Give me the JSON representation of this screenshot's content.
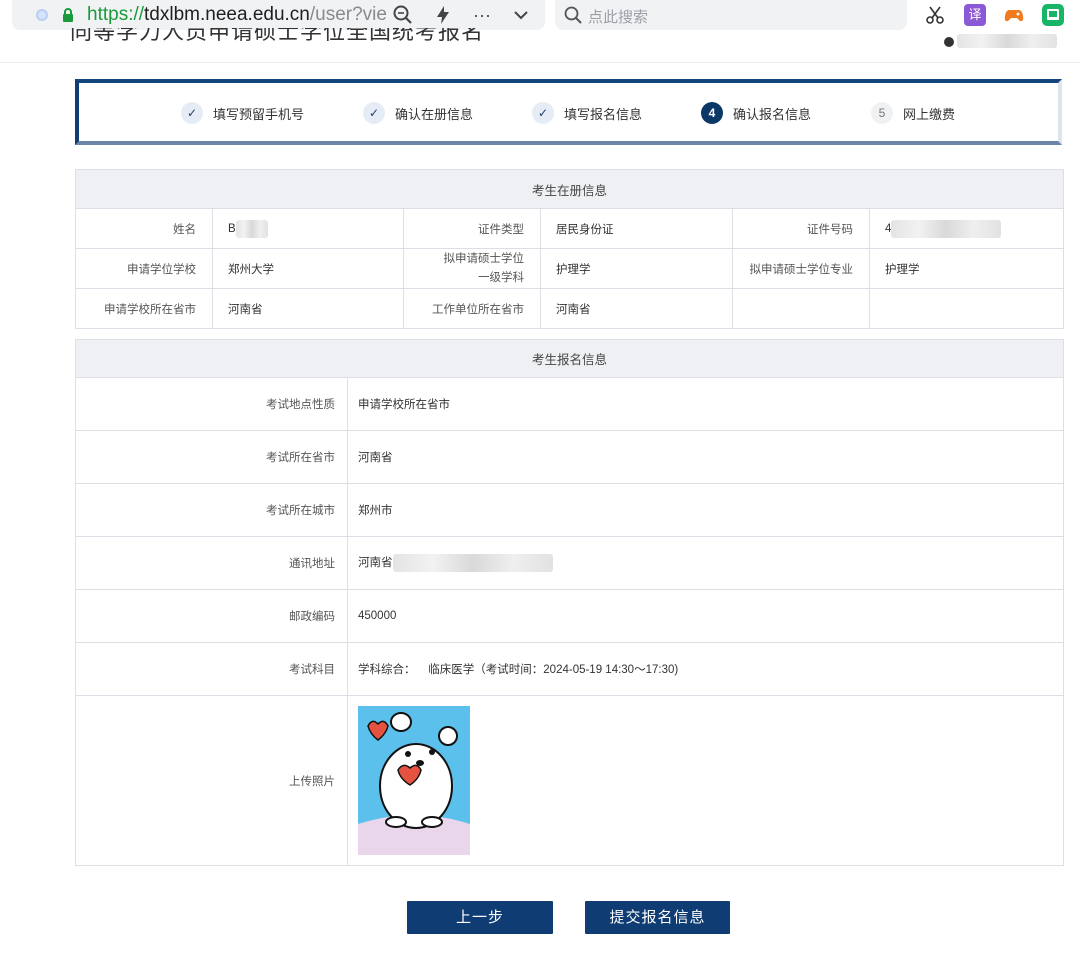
{
  "browser": {
    "url_protocol": "https://",
    "url_host": "tdxlbm.neea.edu.cn",
    "url_path": "/user?vie",
    "search_placeholder": "点此搜索",
    "ext_translate": "译"
  },
  "steps": [
    {
      "num": "",
      "label": "填写预留手机号",
      "state": "done"
    },
    {
      "num": "",
      "label": "确认在册信息",
      "state": "done"
    },
    {
      "num": "",
      "label": "填写报名信息",
      "state": "done"
    },
    {
      "num": "4",
      "label": "确认报名信息",
      "state": "current"
    },
    {
      "num": "5",
      "label": "网上缴费",
      "state": "todo"
    }
  ],
  "registry": {
    "title": "考生在册信息",
    "name_label": "姓名",
    "name_value": "B",
    "id_type_label": "证件类型",
    "id_type_value": "居民身份证",
    "id_no_label": "证件号码",
    "id_no_value": "4",
    "school_label": "申请学位学校",
    "school_value": "郑州大学",
    "discipline_label": "拟申请硕士学位一级学科",
    "discipline_value": "护理学",
    "major_label": "拟申请硕士学位专业",
    "major_value": "护理学",
    "school_province_label": "申请学校所在省市",
    "school_province_value": "河南省",
    "work_province_label": "工作单位所在省市",
    "work_province_value": "河南省"
  },
  "registration": {
    "title": "考生报名信息",
    "rows": [
      {
        "label": "考试地点性质",
        "value": "申请学校所在省市"
      },
      {
        "label": "考试所在省市",
        "value": "河南省"
      },
      {
        "label": "考试所在城市",
        "value": "郑州市"
      },
      {
        "label": "通讯地址",
        "value": "河南省"
      },
      {
        "label": "邮政编码",
        "value": "450000"
      },
      {
        "label": "考试科目",
        "value": "学科综合：    临床医学（考试时间：2024-05-19 14:30～17:30)"
      }
    ],
    "photo_label": "上传照片"
  },
  "buttons": {
    "prev": "上一步",
    "submit": "提交报名信息"
  },
  "colors": {
    "primary": "#0e3c73",
    "header_bg": "#eef0f3",
    "border": "#dcdfe5",
    "url_green": "#1a9a3b"
  }
}
